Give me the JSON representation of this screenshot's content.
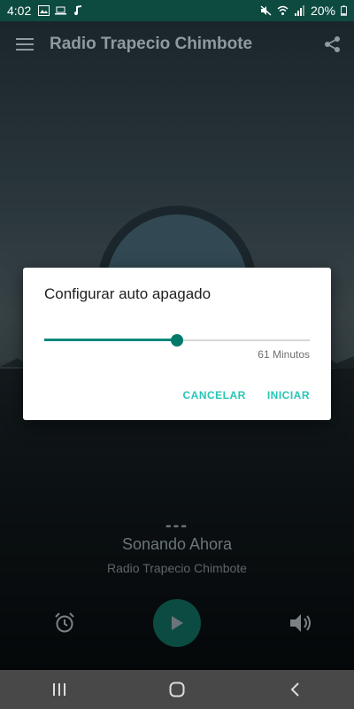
{
  "status_bar": {
    "time": "4:02",
    "battery": "20%",
    "background_color": "#0d4a40"
  },
  "toolbar": {
    "title": "Radio Trapecio Chimbote",
    "menu_icon": "hamburger-menu-icon",
    "share_icon": "share-icon"
  },
  "dialog": {
    "title": "Configurar auto apagado",
    "slider_fraction": 0.5,
    "value_text": "61 Minutos",
    "cancel_label": "CANCELAR",
    "start_label": "INICIAR",
    "accent_color": "#26c6b5"
  },
  "now_playing": {
    "dashes": "---",
    "title": "Sonando Ahora",
    "station": "Radio Trapecio Chimbote"
  },
  "controls": {
    "alarm_icon": "alarm-icon",
    "play_icon": "play-icon",
    "volume_icon": "volume-icon",
    "play_color": "#0b4b41"
  },
  "nav_bar": {
    "recents_icon": "recents-icon",
    "home_icon": "home-icon",
    "back_icon": "back-icon"
  }
}
